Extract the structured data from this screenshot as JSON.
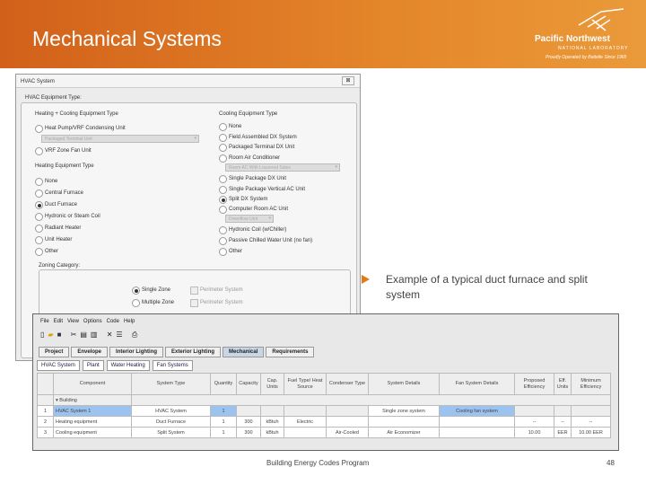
{
  "header": {
    "title": "Mechanical Systems",
    "logo": {
      "name": "Pacific Northwest",
      "sub": "NATIONAL LABORATORY",
      "tagline": "Proudly Operated by Battelle Since 1965"
    },
    "colors": {
      "header": "#e07a1a"
    }
  },
  "dialog": {
    "title": "HVAC System",
    "close": "⊠",
    "equipment_type_label": "HVAC Equipment Type:",
    "heat_cool": {
      "label": "Heating + Cooling Equipment Type",
      "options": [
        "Heat Pump/VRF Condensing Unit",
        "VRF Zone Fan Unit"
      ],
      "dropdown": "Packaged Terminal Unit"
    },
    "heating": {
      "label": "Heating Equipment Type",
      "options": [
        "None",
        "Central Furnace",
        "Duct Furnace",
        "Hydronic or Steam Coil",
        "Radiant Heater",
        "Unit Heater",
        "Other"
      ],
      "selected": "Duct Furnace"
    },
    "cooling": {
      "label": "Cooling Equipment Type",
      "options": [
        "None",
        "Field Assembled DX System",
        "Packaged Terminal DX Unit",
        "Room Air Conditioner",
        "Single Package DX Unit",
        "Single Package Vertical AC Unit",
        "Split DX System",
        "Computer Room AC Unit",
        "Hydronic Coil (w/Chiller)",
        "Passive Chilled Water Unit (no fan)",
        "Other"
      ],
      "selected": "Split DX System",
      "dropdown_room": "Room AC With Louvered Sides",
      "dropdown_crac": "Downflow Unit"
    },
    "zoning": {
      "label": "Zoning Category:",
      "options": [
        "Single Zone",
        "Multiple Zone"
      ],
      "selected": "Single Zone",
      "checks": [
        "Perimeter System",
        "Perimeter System"
      ]
    }
  },
  "note": "Example of a typical duct furnace and split system",
  "app": {
    "menu": [
      "File",
      "Edit",
      "View",
      "Options",
      "Code",
      "Help"
    ],
    "toolbar_icons": [
      "new-icon",
      "open-icon",
      "save-icon",
      "cut-icon",
      "copy-icon",
      "paste-icon",
      "delete-icon",
      "list-icon",
      "print-icon"
    ],
    "tabs": [
      "Project",
      "Envelope",
      "Interior Lighting",
      "Exterior Lighting",
      "Mechanical",
      "Requirements"
    ],
    "active_tab": "Mechanical",
    "subtabs": [
      "HVAC System",
      "Plant",
      "Water Heating",
      "Fan Systems"
    ],
    "table": {
      "headers": [
        "",
        "Component",
        "System Type",
        "Quantity",
        "Capacity",
        "Cap. Units",
        "Fuel Type/ Heat Source",
        "Condenser Type",
        "System Details",
        "Fan System Details",
        "Proposed Efficiency",
        "Eff. Units",
        "Minimum Efficiency"
      ],
      "group": "Building",
      "rows": [
        [
          "1",
          "HVAC System 1",
          "HVAC System",
          "1",
          "",
          "",
          "",
          "",
          "Single zone system",
          "Cooling fan system",
          "",
          "",
          ""
        ],
        [
          "2",
          "Heating equipment",
          "Duct Furnace",
          "1",
          "300",
          "kBtuh",
          "Electric",
          "",
          "",
          "",
          "--",
          "--",
          "--"
        ],
        [
          "3",
          "Cooling equipment",
          "Split System",
          "1",
          "300",
          "kBtuh",
          "",
          "Air-Cooled",
          "Air Economizer",
          "",
          "10.00",
          "EER",
          "10.00 EER"
        ]
      ]
    }
  },
  "footer": {
    "program": "Building Energy Codes Program",
    "page": "48"
  }
}
